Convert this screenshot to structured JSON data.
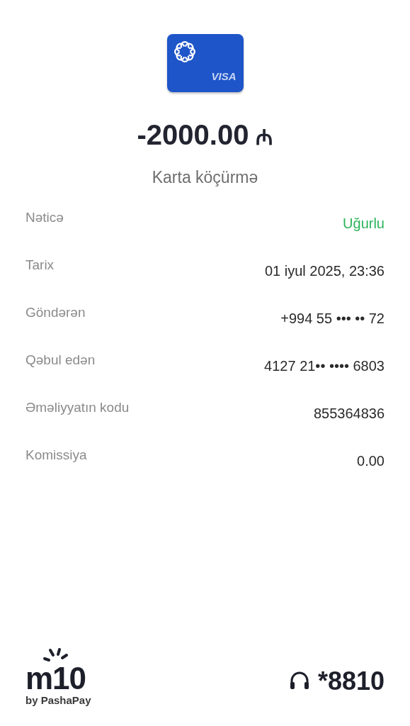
{
  "card": {
    "brand": "VISA"
  },
  "amount": {
    "value": "-2000.00",
    "currency": "₼"
  },
  "subtitle": "Karta köçürmə",
  "details": [
    {
      "label": "Nəticə",
      "value": "Uğurlu",
      "color": "#2bb45a"
    },
    {
      "label": "Tarix",
      "value": "01 iyul 2025, 23:36",
      "color": "#2a2a2a"
    },
    {
      "label": "Göndərən",
      "value": "+994 55 ••• •• 72",
      "color": "#2a2a2a"
    },
    {
      "label": "Qəbul edən",
      "value": "4127 21•• •••• 6803",
      "color": "#2a2a2a"
    },
    {
      "label": "Əməliyyatın kodu",
      "value": "855364836",
      "color": "#2a2a2a"
    },
    {
      "label": "Komissiya",
      "value": "0.00",
      "color": "#2a2a2a"
    }
  ],
  "footer": {
    "logo": "m10",
    "logo_sub": "by PashaPay",
    "support_number": "*8810"
  }
}
